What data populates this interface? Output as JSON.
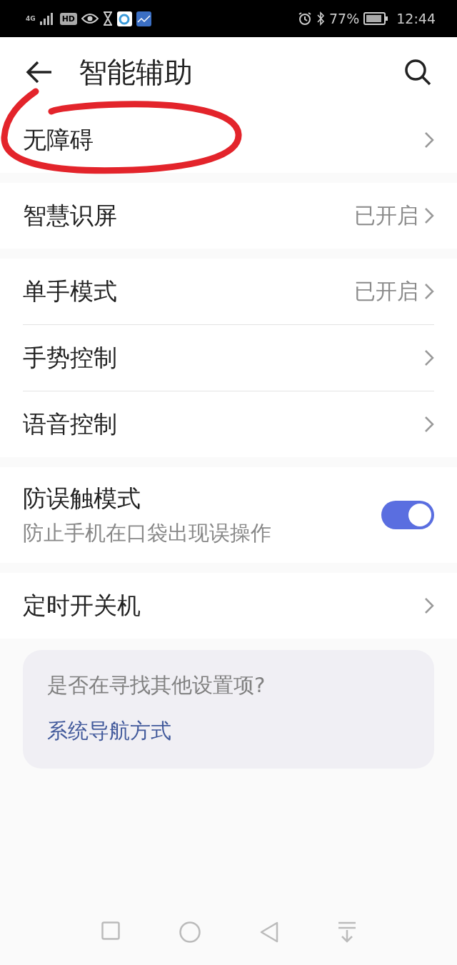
{
  "status_bar": {
    "network": "4G",
    "hd": "HD",
    "battery": "77%",
    "time": "12:44"
  },
  "header": {
    "title": "智能辅助"
  },
  "groups": [
    {
      "items": [
        {
          "kind": "link",
          "label": "无障碍"
        }
      ]
    },
    {
      "items": [
        {
          "kind": "link",
          "label": "智慧识屏",
          "value": "已开启"
        }
      ]
    },
    {
      "items": [
        {
          "kind": "link",
          "label": "单手模式",
          "value": "已开启"
        },
        {
          "kind": "link",
          "label": "手势控制"
        },
        {
          "kind": "link",
          "label": "语音控制"
        }
      ]
    },
    {
      "items": [
        {
          "kind": "switch",
          "label": "防误触模式",
          "description": "防止手机在口袋出现误操作",
          "on": true
        }
      ]
    },
    {
      "items": [
        {
          "kind": "link",
          "label": "定时开关机"
        }
      ]
    }
  ],
  "suggestion": {
    "question": "是否在寻找其他设置项?",
    "link": "系统导航方式"
  }
}
